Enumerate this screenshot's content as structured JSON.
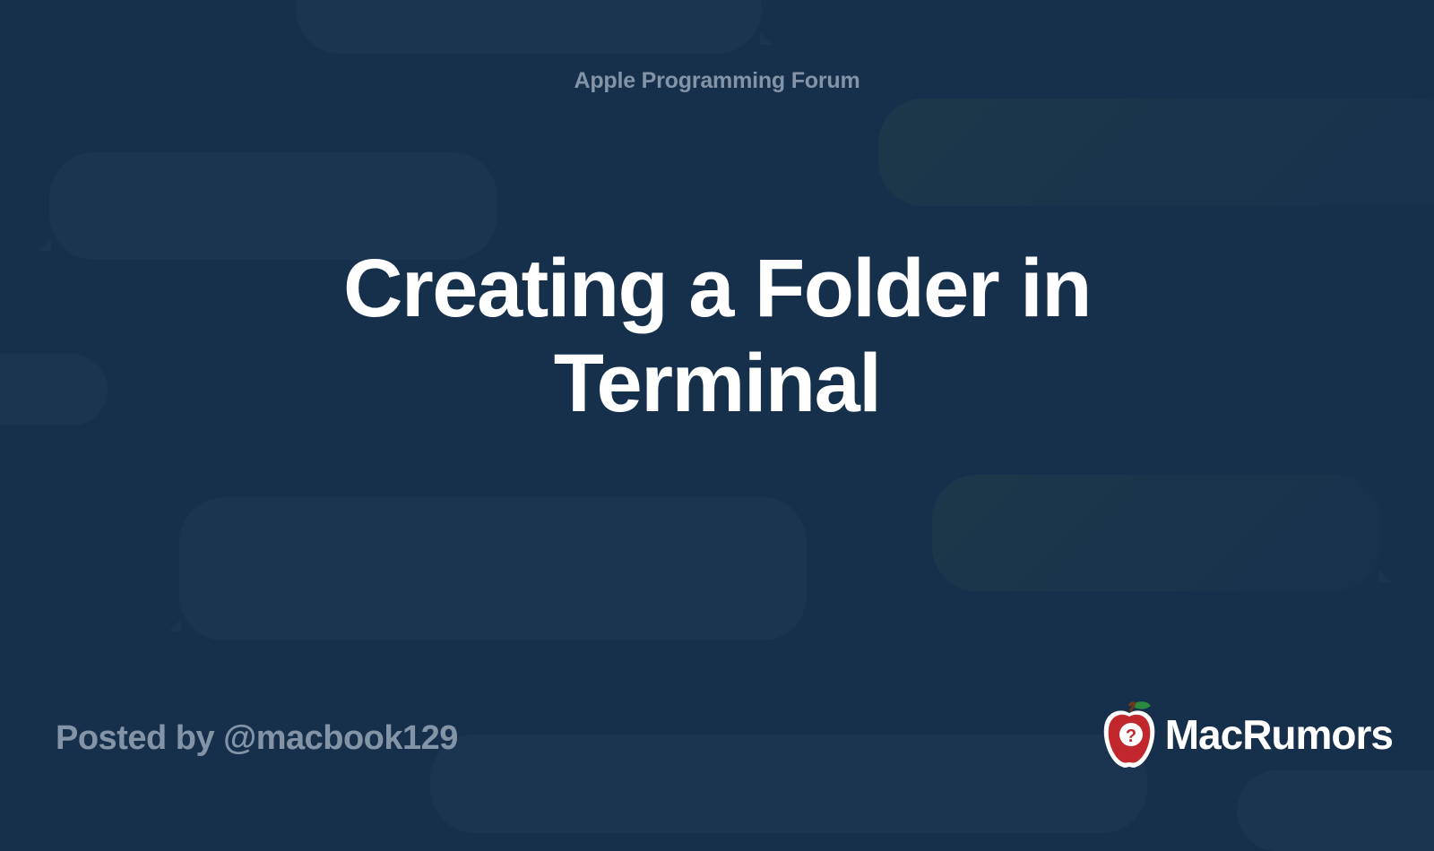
{
  "forum_label": "Apple Programming Forum",
  "title": "Creating a Folder in Terminal",
  "posted_by": "Posted by @macbook129",
  "brand": {
    "name": "MacRumors"
  }
}
